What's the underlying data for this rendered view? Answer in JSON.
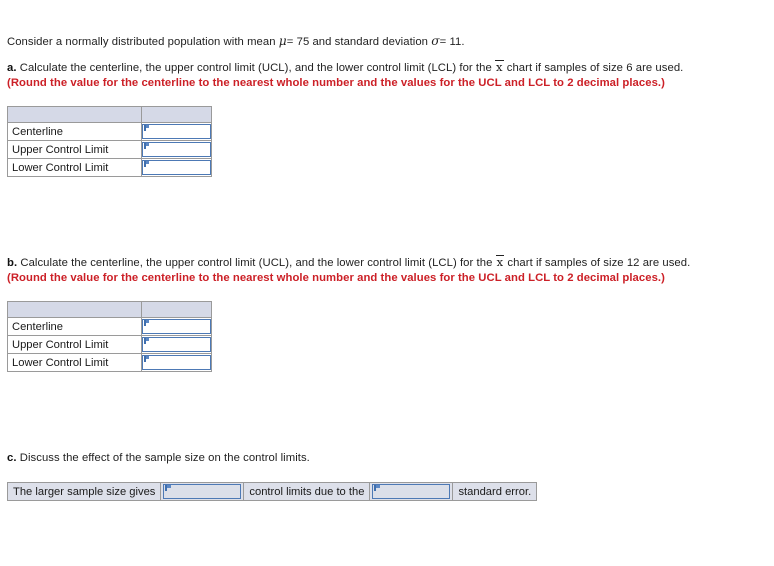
{
  "problem": {
    "intro_before_mu": "Consider a normally distributed population with mean",
    "mu_symbol": "μ",
    "mu_value": "= 75 and standard deviation",
    "sigma_symbol": "σ",
    "sigma_value": "= 11."
  },
  "parts": {
    "a": {
      "label": "a.",
      "text_1": "Calculate the centerline, the upper control limit (UCL), and the lower control limit (LCL) for the",
      "xbar": "x",
      "text_2": "chart if samples of size 6 are used.",
      "instruction": "(Round the value for the centerline to the nearest whole number and the values for the UCL and LCL to 2 decimal places.)",
      "table": {
        "header_left": "",
        "header_right": "",
        "rows": [
          {
            "label": "Centerline",
            "value": ""
          },
          {
            "label": "Upper Control Limit",
            "value": ""
          },
          {
            "label": "Lower Control Limit",
            "value": ""
          }
        ]
      }
    },
    "b": {
      "label": "b.",
      "text_1": "Calculate the centerline, the upper control limit (UCL), and the lower control limit (LCL) for the",
      "xbar": "x",
      "text_2": "chart if samples of size 12 are used.",
      "instruction": "(Round the value for the centerline to the nearest whole number and the values for the UCL and LCL to 2 decimal places.)",
      "table": {
        "header_left": "",
        "header_right": "",
        "rows": [
          {
            "label": "Centerline",
            "value": ""
          },
          {
            "label": "Upper Control Limit",
            "value": ""
          },
          {
            "label": "Lower Control Limit",
            "value": ""
          }
        ]
      }
    },
    "c": {
      "label": "c.",
      "text_1": "Discuss the effect of the sample size on the control limits.",
      "sentence": {
        "segment_1": "The larger sample size gives",
        "dropdown_1_value": "",
        "segment_2": "control limits due to the",
        "dropdown_2_value": "",
        "segment_3": "standard error."
      }
    }
  },
  "colors": {
    "instruction_red": "#cc2027",
    "header_fill": "#d5d9e7",
    "input_border": "#4d79b5",
    "strip_fill": "#dde0ea",
    "table_border": "#9a9a9a"
  }
}
